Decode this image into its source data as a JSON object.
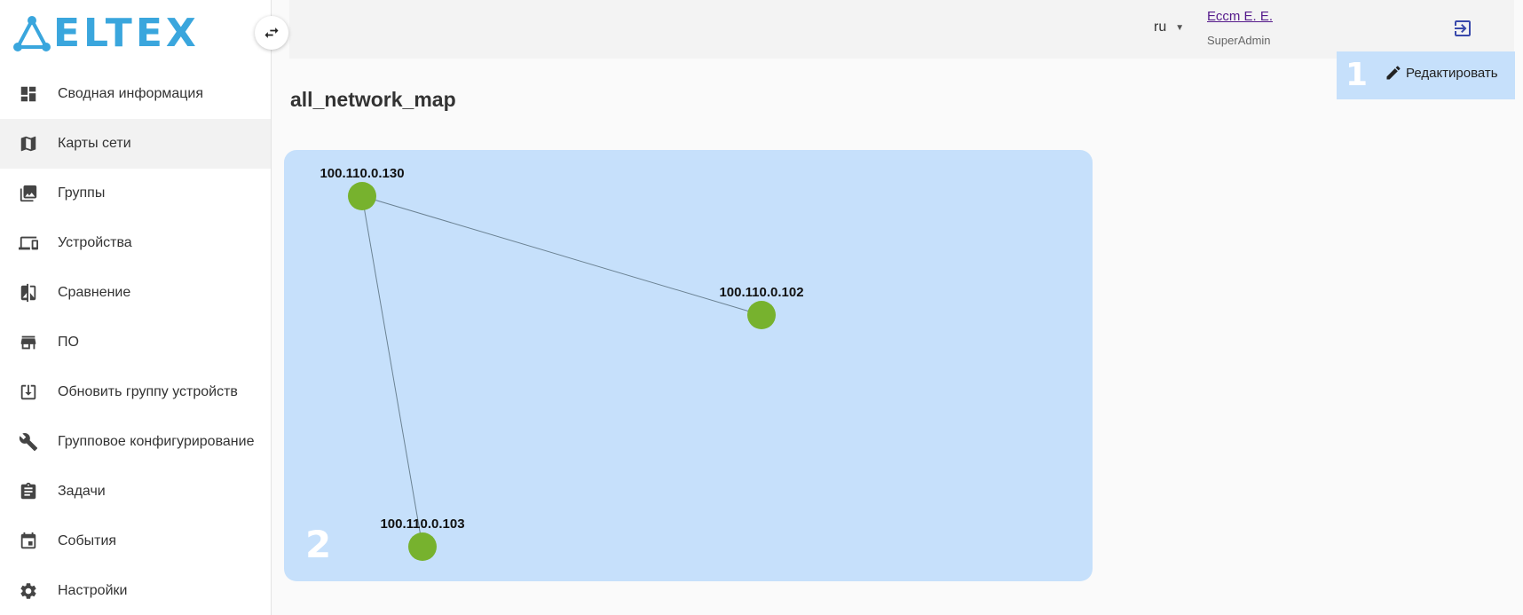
{
  "brand": {
    "name": "ELTEX"
  },
  "sidebar": {
    "items": [
      {
        "label": "Сводная информация",
        "icon": "dashboard-icon"
      },
      {
        "label": "Карты сети",
        "icon": "map-icon",
        "active": true
      },
      {
        "label": "Группы",
        "icon": "groups-icon"
      },
      {
        "label": "Устройства",
        "icon": "devices-icon"
      },
      {
        "label": "Сравнение",
        "icon": "compare-icon"
      },
      {
        "label": "ПО",
        "icon": "store-icon"
      },
      {
        "label": "Обновить группу устройств",
        "icon": "download-icon"
      },
      {
        "label": "Групповое конфигурирование",
        "icon": "wrench-icon"
      },
      {
        "label": "Задачи",
        "icon": "clipboard-icon"
      },
      {
        "label": "События",
        "icon": "calendar-icon"
      },
      {
        "label": "Настройки",
        "icon": "gear-icon"
      }
    ]
  },
  "header": {
    "language": "ru",
    "user_name": "Ессm E. E.",
    "user_role": "SuperAdmin"
  },
  "page": {
    "title": "all_network_map",
    "edit_label": "Редактировать",
    "callout_edit": "1",
    "callout_map": "2"
  },
  "map": {
    "nodes": [
      {
        "id": "n1",
        "label": "100.110.0.130"
      },
      {
        "id": "n2",
        "label": "100.110.0.102"
      },
      {
        "id": "n3",
        "label": "100.110.0.103"
      }
    ],
    "links": [
      {
        "from": "n1",
        "to": "n2"
      },
      {
        "from": "n1",
        "to": "n3"
      }
    ]
  },
  "colors": {
    "brand": "#3aa6dd",
    "map_background": "#c6e0fb",
    "node_fill": "#77b22e",
    "link": "#6b8293",
    "logout_icon": "#3949ab"
  }
}
